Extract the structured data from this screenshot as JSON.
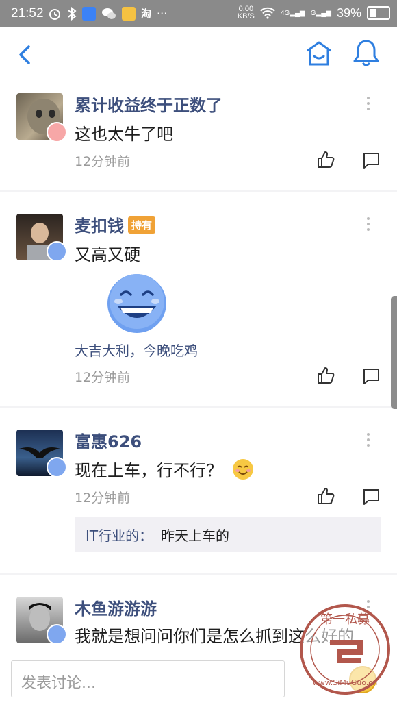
{
  "status_bar": {
    "time": "21:52",
    "net_speed": "0.00",
    "net_unit": "KB/S",
    "signal1": "4G",
    "signal2": "G",
    "battery": "39%",
    "taobao_char": "淘",
    "more": "···"
  },
  "nav": {
    "back_icon": "chevron-left-icon",
    "home_icon": "house-icon",
    "bell_icon": "bell-icon",
    "accent_color": "#2f7fe0"
  },
  "posts": [
    {
      "username": "累计收益终于正数了",
      "text": "这也太牛了吧",
      "time": "12分钟前"
    },
    {
      "username": "麦扣钱",
      "tag": "持有",
      "text": "又高又硬",
      "sticker_caption": "大吉大利，今晚吃鸡",
      "time": "12分钟前"
    },
    {
      "username": "富惠626",
      "text": "现在上车，行不行？",
      "time": "12分钟前",
      "reply": {
        "author": "IT行业的：",
        "text": "昨天上车的"
      }
    },
    {
      "username": "木鱼游游游",
      "text": "我就是想问问你们是怎么抓到这么好的"
    }
  ],
  "bottom": {
    "input_placeholder": "发表讨论..."
  },
  "watermark": {
    "top_text": "第一私募",
    "url_text": "www.SiMuGuo.cn"
  }
}
